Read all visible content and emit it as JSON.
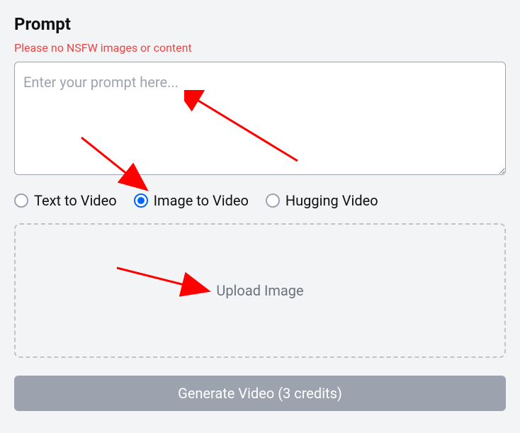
{
  "heading": "Prompt",
  "warning_text": "Please no NSFW images or content",
  "prompt_placeholder": "Enter your prompt here...",
  "radios": {
    "text_to_video": "Text to Video",
    "image_to_video": "Image to Video",
    "hugging_video": "Hugging Video"
  },
  "upload_label": "Upload Image",
  "generate_label": "Generate Video (3 credits)"
}
